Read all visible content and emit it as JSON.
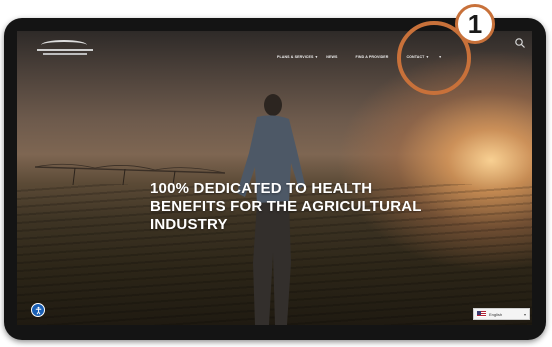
{
  "colors": {
    "accent": "#c8713a",
    "device_frame": "#141414",
    "headline": "#ffffff",
    "a11y_button": "#1a5fb4"
  },
  "header": {
    "logo_icon": "organization-logo-icon",
    "nav": [
      {
        "label": "",
        "has_dropdown": false
      },
      {
        "label": "",
        "has_dropdown": false
      },
      {
        "label": "PLANS & SERVICES",
        "has_dropdown": true
      },
      {
        "label": "NEWS",
        "has_dropdown": false
      },
      {
        "label": "",
        "has_dropdown": false
      },
      {
        "label": "FIND A PROVIDER",
        "has_dropdown": false
      },
      {
        "label": "",
        "has_dropdown": false
      },
      {
        "label": "CONTACT",
        "has_dropdown": true
      },
      {
        "label": "",
        "has_dropdown": true
      }
    ],
    "search_icon": "search-icon"
  },
  "hero": {
    "headline_lines": [
      "100% DEDICATED TO HEALTH",
      "BENEFITS FOR THE AGRICULTURAL",
      "INDUSTRY"
    ]
  },
  "footer": {
    "accessibility_icon": "accessibility-icon",
    "language": {
      "selected": "English",
      "flag_icon": "us-flag-icon",
      "caret_icon": "chevron-down-icon"
    }
  },
  "annotation": {
    "step_number": "1"
  }
}
